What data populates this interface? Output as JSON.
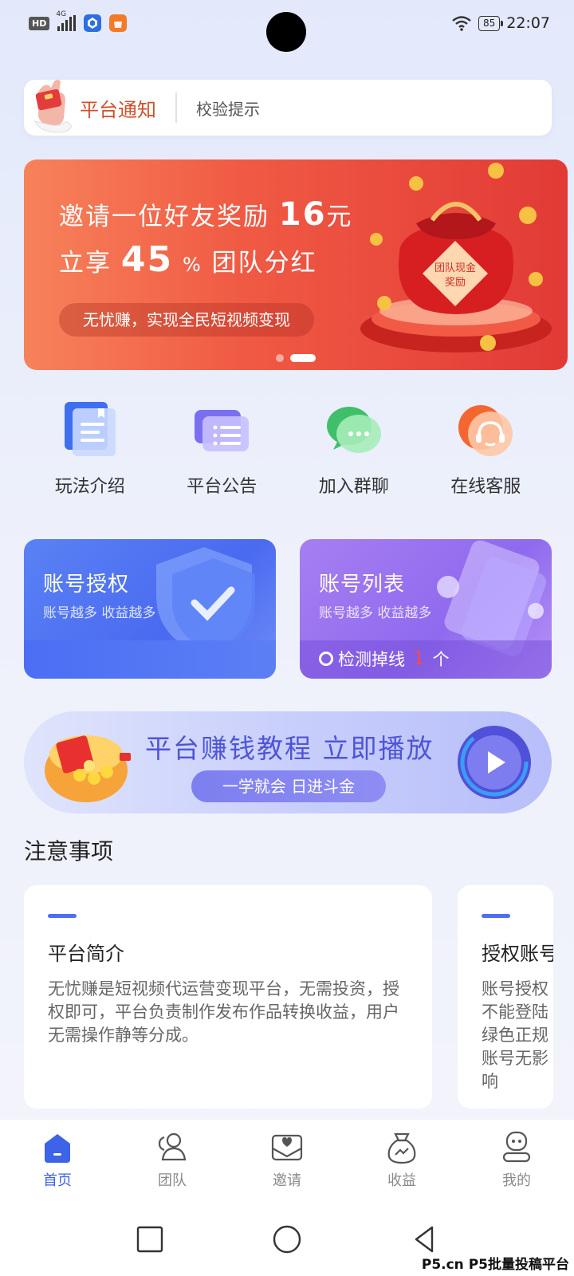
{
  "status_bar": {
    "hd": "HD",
    "network": "4G",
    "battery": "85",
    "time": "22:07"
  },
  "notice": {
    "title": "平台通知",
    "text": "校验提示"
  },
  "banner": {
    "line1_prefix": "邀请一位好友奖励",
    "line1_amount": "16",
    "line1_suffix": "元",
    "line2_prefix": "立享",
    "line2_num": "45",
    "line2_pct": "%",
    "line2_suffix": "团队分红",
    "pill": "无忧赚，实现全民短视频变现",
    "bag_text_1": "团队现金",
    "bag_text_2": "奖励",
    "slides": 2,
    "active_slide": 2
  },
  "quick_links": [
    {
      "label": "玩法介绍",
      "icon": "book-icon"
    },
    {
      "label": "平台公告",
      "icon": "announcement-icon"
    },
    {
      "label": "加入群聊",
      "icon": "chat-bubble-icon"
    },
    {
      "label": "在线客服",
      "icon": "headset-icon"
    }
  ],
  "account_cards": {
    "auth": {
      "title": "账号授权",
      "subtitle": "账号越多 收益越多"
    },
    "list": {
      "title": "账号列表",
      "subtitle": "账号越多 收益越多",
      "status_label": "检测掉线",
      "status_count": "1",
      "status_unit": "个"
    }
  },
  "tutorial": {
    "title": "平台赚钱教程 立即播放",
    "pill": "一学就会 日进斗金"
  },
  "notes": {
    "title": "注意事项",
    "cards": [
      {
        "heading": "平台简介",
        "body": "无忧赚是短视频代运营变现平台，无需投资，授权即可，平台负责制作发布作品转换收益，用户无需操作静等分成。"
      },
      {
        "heading": "授权账号",
        "body": "账号授权 不能登陆 绿色正规 账号无影响"
      }
    ]
  },
  "bottom_nav": [
    {
      "label": "首页",
      "icon": "home-icon",
      "active": true
    },
    {
      "label": "团队",
      "icon": "team-icon",
      "active": false
    },
    {
      "label": "邀请",
      "icon": "invite-envelope-icon",
      "active": false
    },
    {
      "label": "收益",
      "icon": "money-bag-icon",
      "active": false
    },
    {
      "label": "我的",
      "icon": "profile-icon",
      "active": false
    }
  ],
  "watermark": "P5.cn P5批量投稿平台",
  "colors": {
    "accent": "#3d63e8",
    "notice_title": "#d0502a",
    "banner_red": "#e23a36",
    "alert_red": "#f34b4b",
    "tutorial_purple": "#4e55d8"
  }
}
